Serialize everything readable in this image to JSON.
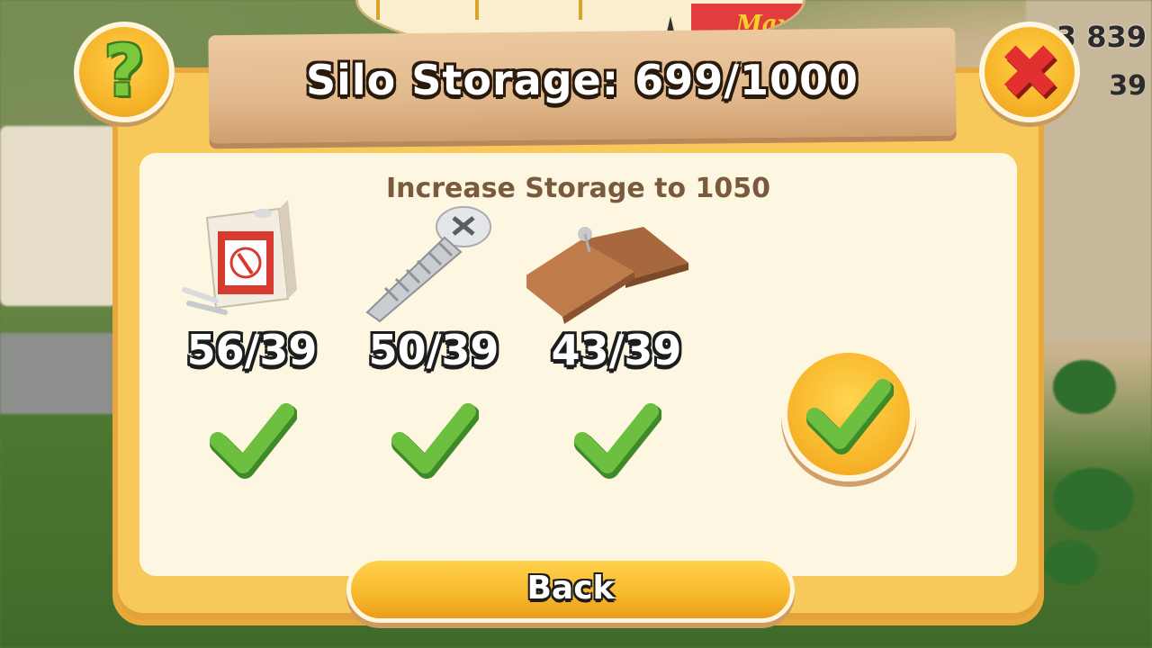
{
  "header": {
    "title": "Silo Storage: 699/1000",
    "max_label": "Max",
    "help_icon": "question-mark-icon",
    "close_icon": "close-icon"
  },
  "hud": {
    "coins_partial": "03 839",
    "diamonds_partial": "39"
  },
  "main": {
    "subtitle": "Increase Storage to 1050",
    "items": [
      {
        "name": "Nails",
        "icon": "nails-box-icon",
        "count": "56/39",
        "status_icon": "check-icon"
      },
      {
        "name": "Screws",
        "icon": "screw-icon",
        "count": "50/39",
        "status_icon": "check-icon"
      },
      {
        "name": "Wood Panels",
        "icon": "wood-panel-icon",
        "count": "43/39",
        "status_icon": "check-icon"
      }
    ],
    "confirm_icon": "check-icon"
  },
  "footer": {
    "back_label": "Back"
  },
  "colors": {
    "panel": "#f7c85a",
    "inner": "#fdf6e1",
    "check_green": "#6cbf3f",
    "close_red": "#e2302e",
    "subtitle_brown": "#7a5a3c"
  }
}
